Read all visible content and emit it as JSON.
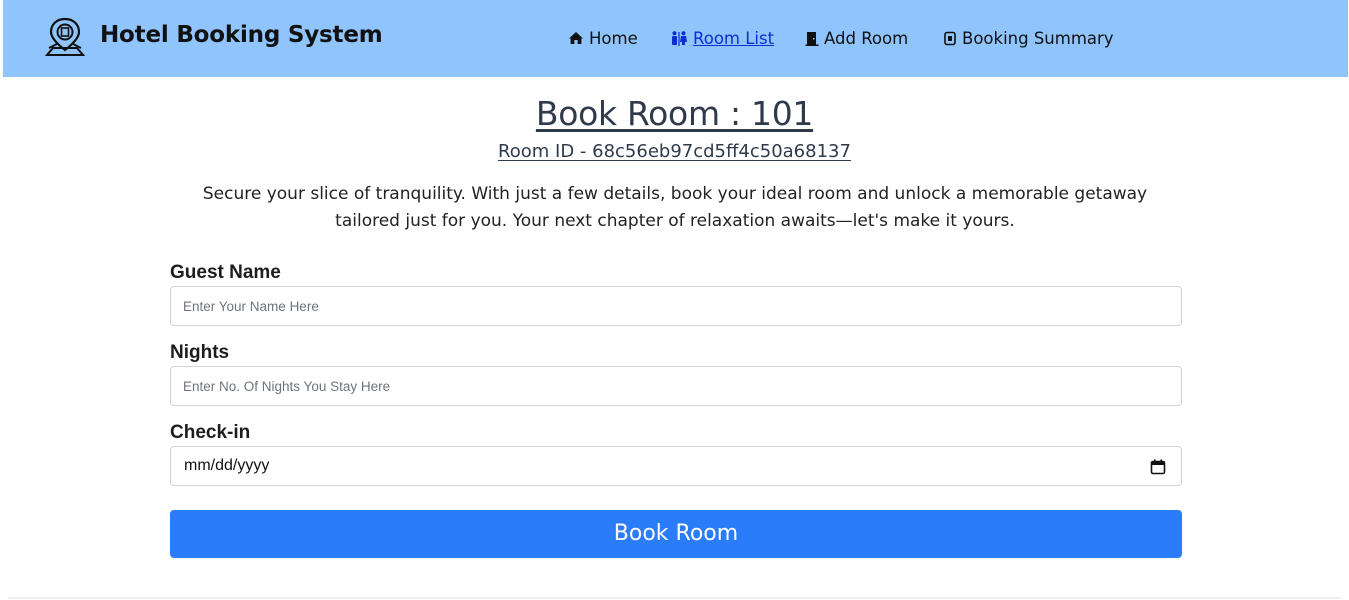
{
  "header": {
    "brand_title": "Hotel Booking System",
    "logo_icon": "hotel-location-pin-icon",
    "nav": [
      {
        "label": "Home",
        "icon": "home-icon",
        "active": false
      },
      {
        "label": "Room List",
        "icon": "people-icon",
        "active": true
      },
      {
        "label": "Add Room",
        "icon": "door-icon",
        "active": false
      },
      {
        "label": "Booking Summary",
        "icon": "receipt-icon",
        "active": false
      }
    ],
    "background_color": "#8fc4fd"
  },
  "main": {
    "title": "Book Room : 101",
    "room_id": "Room ID - 68c56eb97cd5ff4c50a68137",
    "intro": "Secure your slice of tranquility. With just a few details, book your ideal room and unlock a memorable getaway tailored just for you. Your next chapter of relaxation awaits—let's make it yours."
  },
  "form": {
    "guest_name": {
      "label": "Guest Name",
      "placeholder": "Enter Your Name Here",
      "value": ""
    },
    "nights": {
      "label": "Nights",
      "placeholder": "Enter No. Of Nights You Stay Here",
      "value": ""
    },
    "checkin": {
      "label": "Check-in",
      "value": "mm/dd/yyyy"
    },
    "submit_label": "Book Room",
    "submit_color": "#2b7cf8"
  }
}
